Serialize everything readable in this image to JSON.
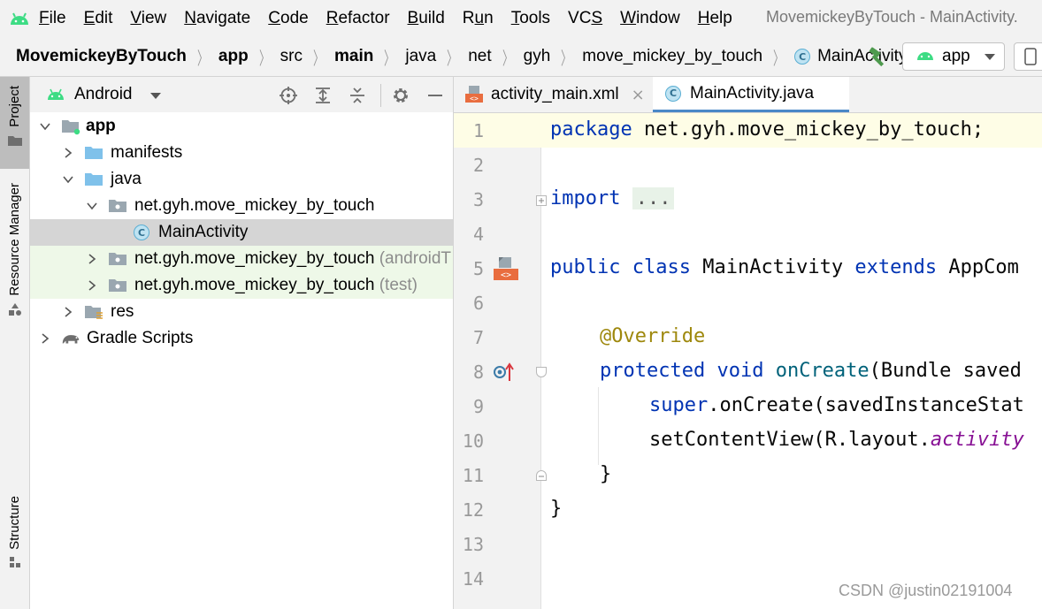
{
  "menubar": {
    "items": [
      {
        "label": "File",
        "mnemonic": "F",
        "rest": "ile"
      },
      {
        "label": "Edit",
        "mnemonic": "E",
        "rest": "dit"
      },
      {
        "label": "View",
        "mnemonic": "V",
        "rest": "iew"
      },
      {
        "label": "Navigate",
        "mnemonic": "N",
        "rest": "avigate"
      },
      {
        "label": "Code",
        "mnemonic": "C",
        "rest": "ode"
      },
      {
        "label": "Refactor",
        "mnemonic": "R",
        "rest": "efactor"
      },
      {
        "label": "Build",
        "mnemonic": "B",
        "rest": "uild"
      },
      {
        "label": "Run",
        "pre": "R",
        "mnemonic": "u",
        "rest": "n"
      },
      {
        "label": "Tools",
        "mnemonic": "T",
        "rest": "ools"
      },
      {
        "label": "VCS",
        "pre": "VC",
        "mnemonic": "S",
        "rest": ""
      },
      {
        "label": "Window",
        "mnemonic": "W",
        "rest": "indow"
      },
      {
        "label": "Help",
        "mnemonic": "H",
        "rest": "elp"
      }
    ],
    "window_title": "MovemickeyByTouch - MainActivity."
  },
  "navbar": {
    "crumbs": [
      "MovemickeyByTouch",
      "app",
      "src",
      "main",
      "java",
      "net",
      "gyh",
      "move_mickey_by_touch",
      "MainActivity"
    ],
    "run_config": "app"
  },
  "toolstrip": {
    "project": "Project",
    "resource_manager": "Resource Manager",
    "structure": "Structure"
  },
  "project_panel": {
    "view_mode": "Android",
    "tree": [
      {
        "label": "app"
      },
      {
        "label": "manifests"
      },
      {
        "label": "java"
      },
      {
        "label": "net.gyh.move_mickey_by_touch"
      },
      {
        "label": "MainActivity"
      },
      {
        "label": "net.gyh.move_mickey_by_touch",
        "suffix": "(androidT"
      },
      {
        "label": "net.gyh.move_mickey_by_touch",
        "suffix": "(test)"
      },
      {
        "label": "res"
      },
      {
        "label": "Gradle Scripts"
      }
    ]
  },
  "editor": {
    "tabs": [
      {
        "label": "activity_main.xml",
        "close": "×"
      },
      {
        "label": "MainActivity.java",
        "close": ""
      }
    ],
    "line_numbers": [
      "1",
      "2",
      "3",
      "4",
      "5",
      "6",
      "7",
      "8",
      "9",
      "10",
      "11",
      "12",
      "13",
      "14"
    ],
    "code": {
      "l1_kw": "package",
      "l1_rest": " net.gyh.move_mickey_by_touch;",
      "l3_kw": "import",
      "l3_fold": "...",
      "l7_kw1": "public",
      "l7_kw2": "class",
      "l7_name": " MainActivity ",
      "l7_kw3": "extends",
      "l7_rest": " AppCom",
      "l9_ann": "@Override",
      "l10_kw1": "protected",
      "l10_kw2": "void",
      "l10_fn": "onCreate",
      "l10_rest": "(Bundle saved",
      "l11_kw": "super",
      "l11_rest": ".onCreate(savedInstanceStat",
      "l12_pre": "setContentView(R.layout.",
      "l12_field": "activity",
      "l13": "}",
      "l14": "}"
    }
  },
  "watermark": "CSDN @justin02191004",
  "colors": {
    "keyword": "#0033b3",
    "annotation": "#9e880d",
    "method": "#00627a",
    "field": "#871094",
    "android_green": "#3ddc84",
    "selection": "#d5d5d5",
    "tab_underline": "#4a88c7"
  }
}
